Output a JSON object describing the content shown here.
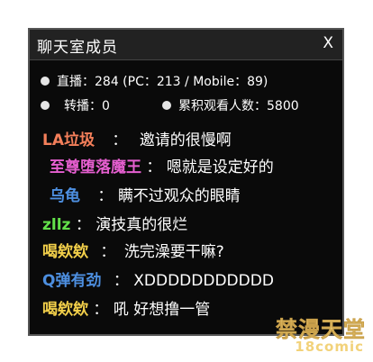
{
  "window": {
    "title": "聊天室成员",
    "close_label": "X"
  },
  "stats": {
    "live": "直播：284 (PC：213 / Mobile：89)",
    "relay": "转播：0",
    "total_viewers": "累积观看人数：5800"
  },
  "chat": [
    {
      "user": "LA垃圾",
      "sep": "：",
      "message": "邀请的很慢啊",
      "color": "#f47f5a"
    },
    {
      "user": "至尊堕落魔王",
      "sep": "：",
      "message": "嗯就是设定好的",
      "color": "#e65fd0"
    },
    {
      "user": "乌龟",
      "sep": "：",
      "message": "瞒不过观众的眼睛",
      "color": "#4d8fe0"
    },
    {
      "user": "zllz",
      "sep": "：",
      "message": "演技真的很烂",
      "color": "#63e04a"
    },
    {
      "user": "喝欸欸",
      "sep": "：",
      "message": "洗完澡要干嘛?",
      "color": "#f2cf4a"
    },
    {
      "user": "Q弹有劲",
      "sep": "：",
      "message": "XDDDDDDDDDDD",
      "color": "#4d8fe0"
    },
    {
      "user": "喝欸欸",
      "sep": "：",
      "message": "吼 好想撸一管",
      "color": "#f2cf4a"
    }
  ],
  "watermark": {
    "line1": "禁漫天堂",
    "line2": "18comic"
  }
}
